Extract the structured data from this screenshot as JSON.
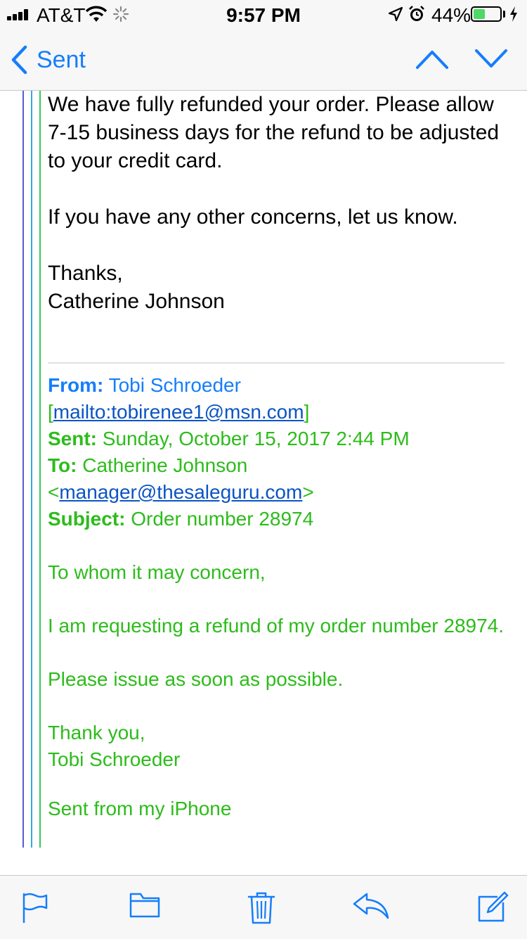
{
  "status_bar": {
    "carrier": "AT&T",
    "time": "9:57 PM",
    "battery_percent": "44%",
    "battery_level": 0.44,
    "icons": [
      "signal-icon",
      "wifi-icon",
      "activity-icon",
      "location-icon",
      "alarm-icon",
      "battery-icon",
      "charging-icon"
    ]
  },
  "nav": {
    "back_label": "Sent",
    "icons": [
      "chevron-left-icon",
      "chevron-up-icon",
      "chevron-down-icon"
    ]
  },
  "reply": {
    "body_line1": "We have fully refunded your order. Please allow 7-15 business days for the refund to be adjusted to your credit card.",
    "body_line2": "If you have any other concerns, let us know.",
    "closing": "Thanks,",
    "signature": "Catherine Johnson"
  },
  "quoted": {
    "from_label": "From:",
    "from_name": "Tobi Schroeder",
    "from_mailto_prefix": "[",
    "from_mailto": "mailto:tobirenee1@msn.com",
    "from_mailto_suffix": "]",
    "sent_label": "Sent:",
    "sent_value": "Sunday, October 15, 2017 2:44 PM",
    "to_label": "To:",
    "to_name": "Catherine Johnson",
    "to_prefix": "<",
    "to_email": "manager@thesaleguru.com",
    "to_suffix": ">",
    "subject_label": "Subject:",
    "subject_value": "Order number 28974",
    "greeting": "To whom it may concern,",
    "request": "I am requesting a refund of my order number 28974.",
    "urgency": "Please issue as soon as possible.",
    "closing": "Thank you,",
    "signature": "Tobi Schroeder",
    "footer": "Sent from my iPhone"
  },
  "toolbar": {
    "icons": [
      "flag-icon",
      "folder-icon",
      "trash-icon",
      "reply-icon",
      "compose-icon"
    ]
  },
  "colors": {
    "accent": "#157efb",
    "quoted_text": "#2dbc1b",
    "link": "#0b54c4"
  }
}
